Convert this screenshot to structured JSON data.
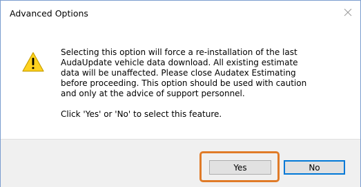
{
  "window": {
    "title": "Advanced Options",
    "close_icon": "close-icon"
  },
  "message": {
    "icon": "warning-icon",
    "line1": "Selecting this option will force a re-installation of the last\nAudaUpdate vehicle data download.  All existing estimate\ndata will be unaffected.  Please close Audatex Estimating\nbefore proceeding.  This option should be used with caution\nand only at the advice of support personnel.",
    "line2": "Click 'Yes' or 'No' to select this feature."
  },
  "buttons": {
    "yes_label": "Yes",
    "no_label": "No"
  },
  "colors": {
    "highlight": "#e07b28",
    "focus_border": "#0078d7",
    "footer_bg": "#f0f0f0"
  }
}
